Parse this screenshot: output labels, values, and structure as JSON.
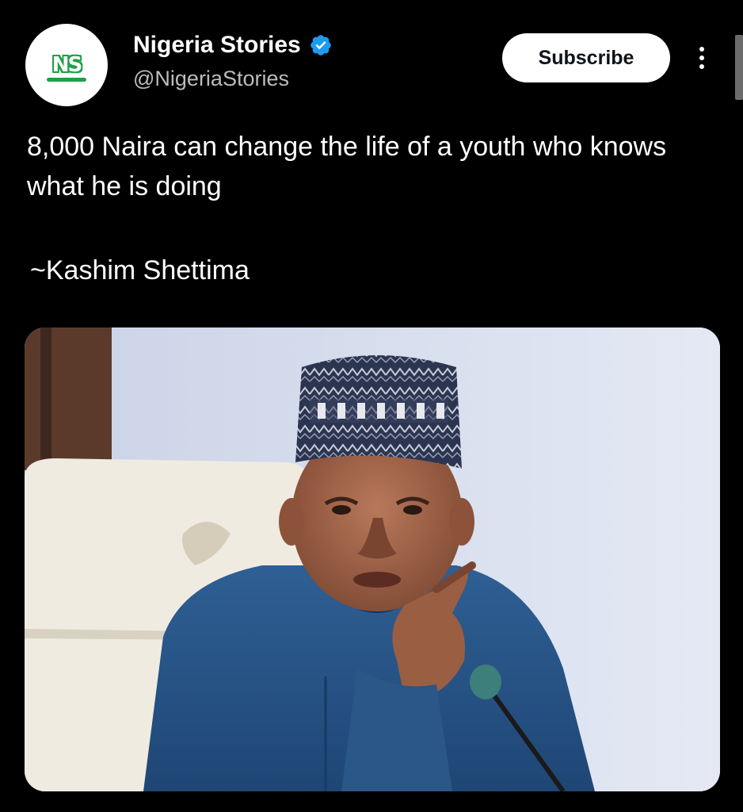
{
  "account": {
    "display_name": "Nigeria Stories",
    "handle": "@NigeriaStories",
    "avatar_logo_text": "NS",
    "verified": true,
    "verified_icon": "verified-badge-icon"
  },
  "actions": {
    "subscribe_label": "Subscribe",
    "more_icon": "more-vertical-icon"
  },
  "post": {
    "text": "8,000 Naira can change the life of a youth who knows what he is doing",
    "attribution": "~Kashim Shettima"
  },
  "media": {
    "kind": "photo",
    "subject": "man-in-blue-kaftan-and-embroidered-cap-gesturing"
  },
  "colors": {
    "background": "#000000",
    "text": "#ffffff",
    "handle": "#b9bcc0",
    "verified_blue": "#1d9bf0",
    "subscribe_bg": "#ffffff",
    "brand_green": "#1fa049"
  }
}
